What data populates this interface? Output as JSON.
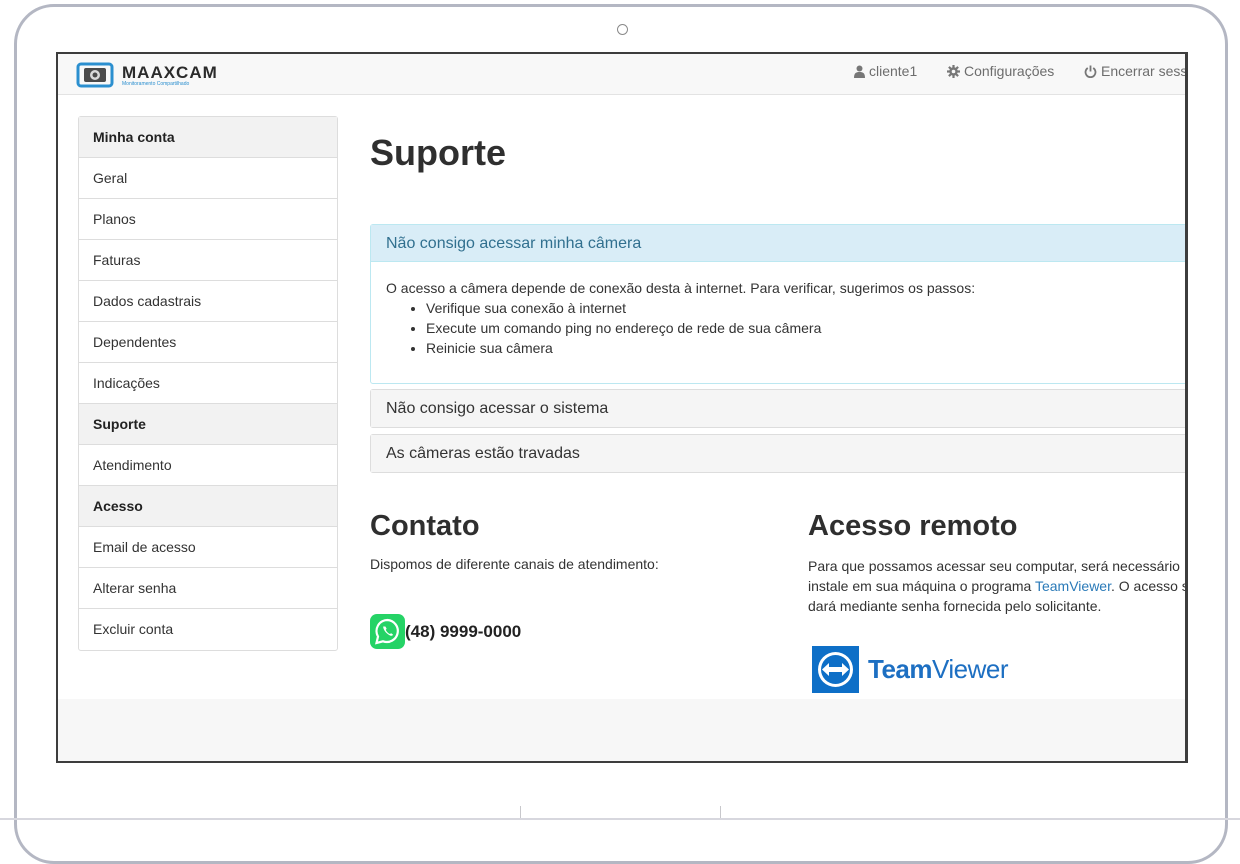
{
  "navbar": {
    "logo_text": "MAAXCAM",
    "logo_subtitle": "Monitoramento Compartilhado",
    "user_label": "cliente1",
    "settings_label": "Configurações",
    "logout_label": "Encerrar sess"
  },
  "sidebar": {
    "items": [
      {
        "label": "Minha conta",
        "header": true
      },
      {
        "label": "Geral"
      },
      {
        "label": "Planos"
      },
      {
        "label": "Faturas"
      },
      {
        "label": "Dados cadastrais"
      },
      {
        "label": "Dependentes"
      },
      {
        "label": "Indicações"
      },
      {
        "label": "Suporte",
        "header": true
      },
      {
        "label": "Atendimento"
      },
      {
        "label": "Acesso",
        "header": true
      },
      {
        "label": "Email de acesso"
      },
      {
        "label": "Alterar senha"
      },
      {
        "label": "Excluir conta"
      }
    ]
  },
  "main": {
    "title": "Suporte",
    "faq": [
      {
        "title": "Não consigo acessar minha câmera",
        "expanded": true,
        "intro": "O acesso a câmera depende de conexão desta à internet. Para verificar, sugerimos os passos:",
        "steps": [
          "Verifique sua conexão à internet",
          "Execute um comando ping no endereço de rede de sua câmera",
          "Reinicie sua câmera"
        ]
      },
      {
        "title": "Não consigo acessar o sistema",
        "expanded": false
      },
      {
        "title": "As câmeras estão travadas",
        "expanded": false
      }
    ],
    "contact": {
      "title": "Contato",
      "text": "Dispomos de diferente canais de atendimento:",
      "phone": "(48) 9999-0000"
    },
    "remote": {
      "title": "Acesso remoto",
      "line1": "Para que possamos acessar seu computar, será necessário",
      "line2_before": "instale em sua máquina o programa ",
      "line2_link": "TeamViewer",
      "line2_after": ". O acesso s",
      "line3": "dará mediante senha fornecida pelo solicitante.",
      "logo_bold": "Team",
      "logo_regular": "Viewer"
    }
  },
  "colors": {
    "accent": "#2a7ab8",
    "panel_active_bg": "#d9edf7",
    "panel_active_text": "#31708f",
    "whatsapp": "#25d366",
    "teamviewer": "#0e6fc7"
  }
}
